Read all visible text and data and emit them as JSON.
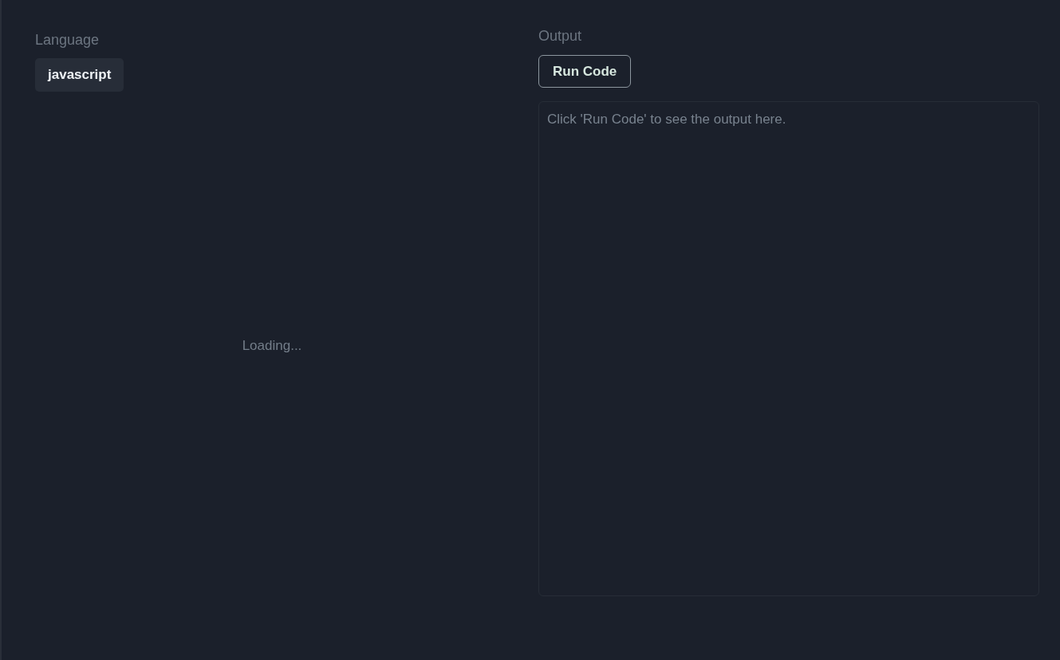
{
  "editor": {
    "label": "Language",
    "language_button": "javascript",
    "status": "Loading..."
  },
  "output": {
    "label": "Output",
    "run_button": "Run Code",
    "message": "Click 'Run Code' to see the output here."
  }
}
